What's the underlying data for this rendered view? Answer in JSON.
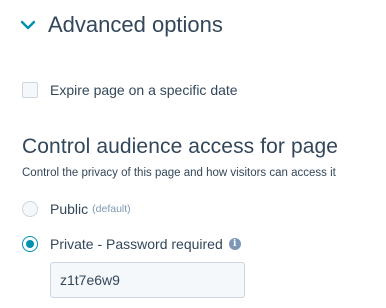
{
  "section": {
    "title": "Advanced options",
    "icon": "chevron-down-icon",
    "expanded": true
  },
  "expire_option": {
    "label": "Expire page on a specific date",
    "checked": false
  },
  "audience_access": {
    "heading": "Control audience access for page",
    "help_text": "Control the privacy of this page and how visitors can access it",
    "options": [
      {
        "label": "Public",
        "sublabel": "(default)",
        "selected": false
      },
      {
        "label": "Private - Password required",
        "selected": true,
        "icon": "info-icon"
      }
    ],
    "password_value": "z1t7e6w9"
  },
  "colors": {
    "text": "#33475b",
    "accent": "#0091ae",
    "muted": "#7c98b6",
    "border": "#cbd6e2",
    "field_bg": "#f5f8fa"
  }
}
